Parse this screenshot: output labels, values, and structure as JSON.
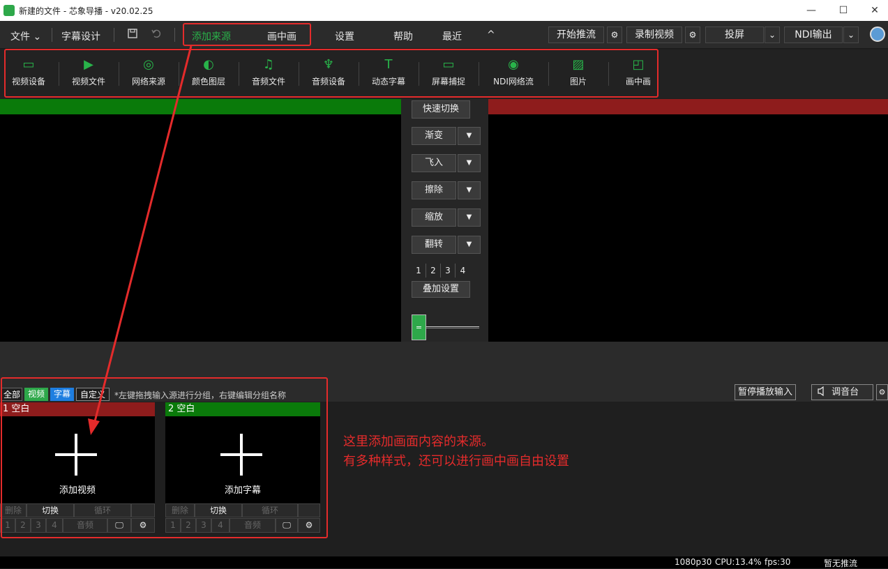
{
  "window": {
    "title": "新建的文件 - 芯象导播 - v20.02.25",
    "minimize": "—",
    "maximize": "☐",
    "close": "✕"
  },
  "menubar": {
    "file": "文件",
    "file_caret": "⌄",
    "subtitle_design": "字幕设计",
    "save_icon": "save-icon",
    "undo_icon": "undo-icon",
    "add_source": "添加来源",
    "pip": "画中画",
    "settings": "设置",
    "help": "帮助",
    "recent": "最近",
    "collapse": "^",
    "start_stream": "开始推流",
    "record": "录制视频",
    "project": "投屏",
    "ndi_out": "NDI输出",
    "gear": "⚙",
    "caret": "⌄"
  },
  "toolbar": [
    {
      "label": "视频设备",
      "icon": "camera-icon",
      "glyph": "▭"
    },
    {
      "label": "视频文件",
      "icon": "video-file-icon",
      "glyph": "▶"
    },
    {
      "label": "网络来源",
      "icon": "network-icon",
      "glyph": "◎"
    },
    {
      "label": "颜色图层",
      "icon": "palette-icon",
      "glyph": "◐"
    },
    {
      "label": "音频文件",
      "icon": "audio-file-icon",
      "glyph": "♫"
    },
    {
      "label": "音频设备",
      "icon": "microphone-icon",
      "glyph": "♆"
    },
    {
      "label": "动态字幕",
      "icon": "text-icon",
      "glyph": "T"
    },
    {
      "label": "屏幕捕捉",
      "icon": "monitor-icon",
      "glyph": "▭"
    },
    {
      "label": "NDI网络流",
      "icon": "ndi-icon",
      "glyph": "◉"
    },
    {
      "label": "图片",
      "icon": "image-icon",
      "glyph": "▨"
    },
    {
      "label": "画中画",
      "icon": "pip-icon",
      "glyph": "◰"
    }
  ],
  "center": {
    "quick_switch": "快速切换",
    "transitions": [
      "渐变",
      "飞入",
      "擦除",
      "缩放",
      "翻转"
    ],
    "dropdown_caret": "▼",
    "overlay_nums": [
      "1",
      "2",
      "3",
      "4"
    ],
    "overlay_settings": "叠加设置",
    "fader_handle": "="
  },
  "groups": {
    "tabs": [
      "全部",
      "视频",
      "字幕",
      "自定义"
    ],
    "hint": "*左键拖拽输入源进行分组，右键编辑分组名称",
    "pause_input": "暂停播放输入",
    "mixer": "调音台",
    "mixer_icon": "speaker-icon",
    "gear": "⚙"
  },
  "sources": [
    {
      "header": "1 空白",
      "label": "添加视频",
      "delete": "删除",
      "switch": "切换",
      "loop": "循环",
      "nums": [
        "1",
        "2",
        "3",
        "4"
      ],
      "audio": "音频",
      "monitor": "🖵",
      "gear": "⚙",
      "color": "#8e1c1c"
    },
    {
      "header": "2 空白",
      "label": "添加字幕",
      "delete": "删除",
      "switch": "切换",
      "loop": "循环",
      "nums": [
        "1",
        "2",
        "3",
        "4"
      ],
      "audio": "音频",
      "monitor": "🖵",
      "gear": "⚙",
      "color": "#0a7a0a"
    }
  ],
  "annotation": {
    "line1": "这里添加画面内容的来源。",
    "line2": "有多种样式，还可以进行画中画自由设置"
  },
  "status": {
    "resolution": "1080p30",
    "cpu": "CPU:13.4%",
    "fps": "fps:30",
    "stream": "暂无推流"
  }
}
